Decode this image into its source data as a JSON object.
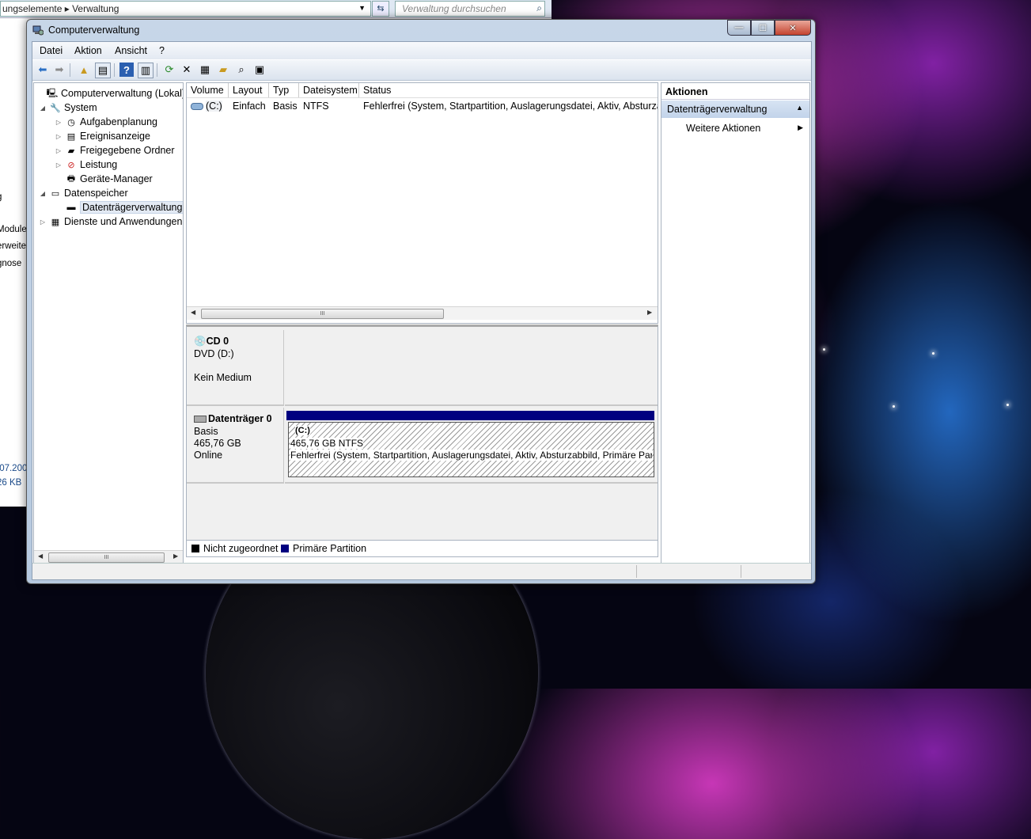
{
  "background_window": {
    "address_text": "ungselemente ▸ Verwaltung",
    "search_placeholder": "Verwaltung durchsuchen",
    "left_list": [
      "g",
      "Module",
      "erweite",
      "gnose",
      ".07.200",
      "26 KB"
    ]
  },
  "window": {
    "title": "Computerverwaltung",
    "controls": {
      "minimize": "—",
      "maximize": "☐",
      "close": "✕"
    }
  },
  "menu": [
    "Datei",
    "Aktion",
    "Ansicht",
    "?"
  ],
  "toolbar": {
    "icons": [
      "back-icon",
      "forward-icon",
      "up-folder-icon",
      "show-hide-tree-icon",
      "help-icon",
      "show-hide-action-icon",
      "refresh-icon",
      "delete-icon",
      "properties-icon",
      "open-icon",
      "search-icon",
      "settings-icon"
    ]
  },
  "tree": {
    "root": "Computerverwaltung (Lokal)",
    "system": "System",
    "system_children": [
      "Aufgabenplanung",
      "Ereignisanzeige",
      "Freigegebene Ordner",
      "Leistung",
      "Geräte-Manager"
    ],
    "storage": "Datenspeicher",
    "disk_mgmt": "Datenträgerverwaltung",
    "services": "Dienste und Anwendungen"
  },
  "volume_list": {
    "columns": [
      "Volume",
      "Layout",
      "Typ",
      "Dateisystem",
      "Status"
    ],
    "rows": [
      {
        "volume": "(C:)",
        "layout": "Einfach",
        "typ": "Basis",
        "dateisystem": "NTFS",
        "status": "Fehlerfrei (System, Startpartition, Auslagerungsdatei, Aktiv, Absturzabbild, Primäre Partition)"
      }
    ],
    "scroll_grip": "III"
  },
  "disks": {
    "cd": {
      "name": "CD 0",
      "type": "DVD (D:)",
      "media": "Kein Medium"
    },
    "disk0": {
      "name": "Datenträger 0",
      "type": "Basis",
      "size": "465,76 GB",
      "state": "Online",
      "partition": {
        "label": "(C:)",
        "size_fs": "465,76 GB NTFS",
        "status": "Fehlerfrei (System, Startpartition, Auslagerungsdatei, Aktiv, Absturzabbild, Primäre Partition)"
      }
    }
  },
  "legend": {
    "unallocated": "Nicht zugeordnet",
    "primary": "Primäre Partition",
    "unallocated_color": "#000000",
    "primary_color": "#000080"
  },
  "actions": {
    "header": "Aktionen",
    "section": "Datenträgerverwaltung",
    "more": "Weitere Aktionen"
  },
  "tree_scroll_grip": "III"
}
